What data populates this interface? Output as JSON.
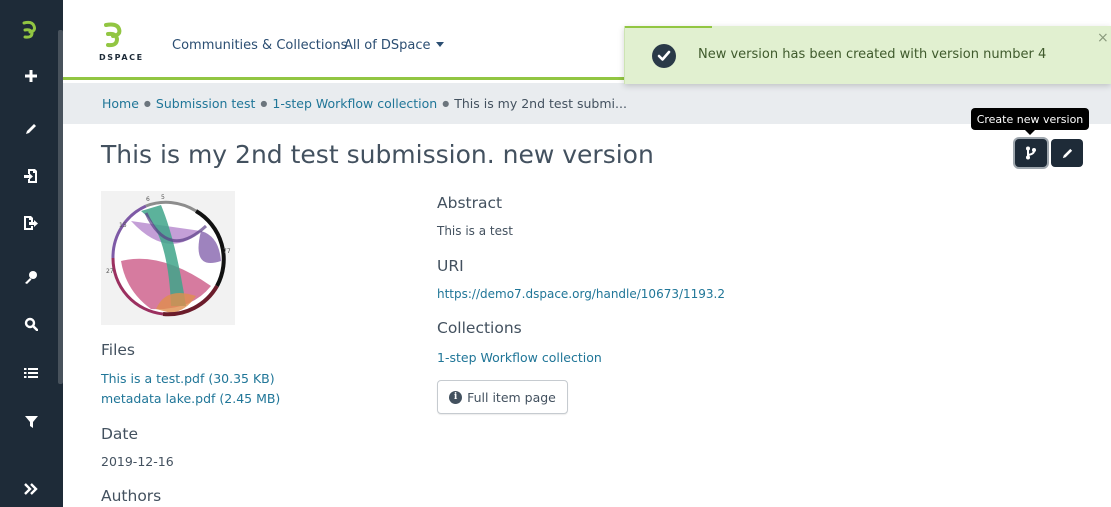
{
  "sidebar": {
    "items": [
      {
        "name": "dspace-logo-icon",
        "label": "DSpace home"
      },
      {
        "name": "plus-icon",
        "label": "New"
      },
      {
        "name": "pencil-icon",
        "label": "Edit"
      },
      {
        "name": "import-icon",
        "label": "Import"
      },
      {
        "name": "export-icon",
        "label": "Export"
      },
      {
        "name": "key-icon",
        "label": "Access Control"
      },
      {
        "name": "search-icon",
        "label": "Admin Search"
      },
      {
        "name": "list-icon",
        "label": "Registries"
      },
      {
        "name": "filter-icon",
        "label": "Curation Task"
      },
      {
        "name": "double-chevron-right-icon",
        "label": "Expand sidebar"
      }
    ]
  },
  "header": {
    "logo_text": "DSPACE",
    "nav": {
      "communities": "Communities & Collections",
      "all_of_dspace": "All of DSpace"
    },
    "accent_color": "#92c642"
  },
  "breadcrumb": {
    "items": [
      "Home",
      "Submission test",
      "1-step Workflow collection"
    ],
    "current": "This is my 2nd test submi..."
  },
  "page": {
    "title": "This is my 2nd test submission. new version",
    "tooltip": "Create new version"
  },
  "left_column": {
    "files_heading": "Files",
    "files": [
      "This is a test.pdf (30.35 KB)",
      "metadata lake.pdf (2.45 MB)"
    ],
    "date_heading": "Date",
    "date_value": "2019-12-16",
    "authors_heading": "Authors"
  },
  "right_column": {
    "abstract_heading": "Abstract",
    "abstract_value": "This is a test",
    "uri_heading": "URI",
    "uri_value": "https://demo7.dspace.org/handle/10673/1193.2",
    "collections_heading": "Collections",
    "collections_value": "1-step Workflow collection",
    "full_item_button": "Full item page"
  },
  "toast": {
    "message": "New version has been created with version number 4",
    "close": "×",
    "status_color": "#92c642"
  },
  "thumbnail": {
    "labels": [
      "15",
      "6",
      "5",
      "77",
      "27"
    ]
  }
}
